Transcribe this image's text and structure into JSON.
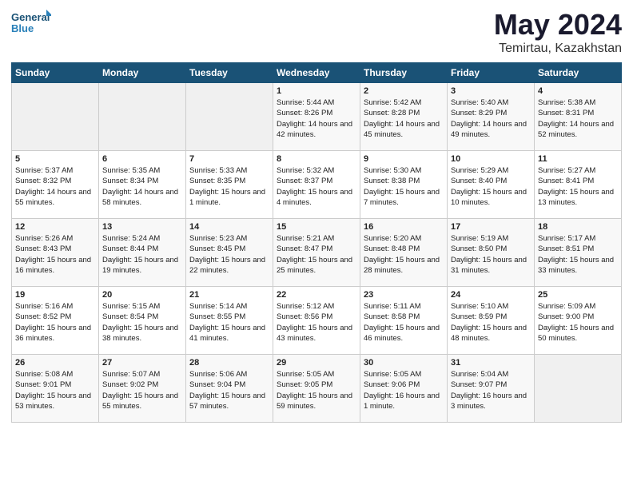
{
  "header": {
    "logo_line1": "General",
    "logo_line2": "Blue",
    "title": "May 2024",
    "location": "Temirtau, Kazakhstan"
  },
  "weekdays": [
    "Sunday",
    "Monday",
    "Tuesday",
    "Wednesday",
    "Thursday",
    "Friday",
    "Saturday"
  ],
  "weeks": [
    [
      {
        "day": "",
        "empty": true
      },
      {
        "day": "",
        "empty": true
      },
      {
        "day": "",
        "empty": true
      },
      {
        "day": "1",
        "sunrise": "5:44 AM",
        "sunset": "8:26 PM",
        "daylight": "14 hours and 42 minutes."
      },
      {
        "day": "2",
        "sunrise": "5:42 AM",
        "sunset": "8:28 PM",
        "daylight": "14 hours and 45 minutes."
      },
      {
        "day": "3",
        "sunrise": "5:40 AM",
        "sunset": "8:29 PM",
        "daylight": "14 hours and 49 minutes."
      },
      {
        "day": "4",
        "sunrise": "5:38 AM",
        "sunset": "8:31 PM",
        "daylight": "14 hours and 52 minutes."
      }
    ],
    [
      {
        "day": "5",
        "sunrise": "5:37 AM",
        "sunset": "8:32 PM",
        "daylight": "14 hours and 55 minutes."
      },
      {
        "day": "6",
        "sunrise": "5:35 AM",
        "sunset": "8:34 PM",
        "daylight": "14 hours and 58 minutes."
      },
      {
        "day": "7",
        "sunrise": "5:33 AM",
        "sunset": "8:35 PM",
        "daylight": "15 hours and 1 minute."
      },
      {
        "day": "8",
        "sunrise": "5:32 AM",
        "sunset": "8:37 PM",
        "daylight": "15 hours and 4 minutes."
      },
      {
        "day": "9",
        "sunrise": "5:30 AM",
        "sunset": "8:38 PM",
        "daylight": "15 hours and 7 minutes."
      },
      {
        "day": "10",
        "sunrise": "5:29 AM",
        "sunset": "8:40 PM",
        "daylight": "15 hours and 10 minutes."
      },
      {
        "day": "11",
        "sunrise": "5:27 AM",
        "sunset": "8:41 PM",
        "daylight": "15 hours and 13 minutes."
      }
    ],
    [
      {
        "day": "12",
        "sunrise": "5:26 AM",
        "sunset": "8:43 PM",
        "daylight": "15 hours and 16 minutes."
      },
      {
        "day": "13",
        "sunrise": "5:24 AM",
        "sunset": "8:44 PM",
        "daylight": "15 hours and 19 minutes."
      },
      {
        "day": "14",
        "sunrise": "5:23 AM",
        "sunset": "8:45 PM",
        "daylight": "15 hours and 22 minutes."
      },
      {
        "day": "15",
        "sunrise": "5:21 AM",
        "sunset": "8:47 PM",
        "daylight": "15 hours and 25 minutes."
      },
      {
        "day": "16",
        "sunrise": "5:20 AM",
        "sunset": "8:48 PM",
        "daylight": "15 hours and 28 minutes."
      },
      {
        "day": "17",
        "sunrise": "5:19 AM",
        "sunset": "8:50 PM",
        "daylight": "15 hours and 31 minutes."
      },
      {
        "day": "18",
        "sunrise": "5:17 AM",
        "sunset": "8:51 PM",
        "daylight": "15 hours and 33 minutes."
      }
    ],
    [
      {
        "day": "19",
        "sunrise": "5:16 AM",
        "sunset": "8:52 PM",
        "daylight": "15 hours and 36 minutes."
      },
      {
        "day": "20",
        "sunrise": "5:15 AM",
        "sunset": "8:54 PM",
        "daylight": "15 hours and 38 minutes."
      },
      {
        "day": "21",
        "sunrise": "5:14 AM",
        "sunset": "8:55 PM",
        "daylight": "15 hours and 41 minutes."
      },
      {
        "day": "22",
        "sunrise": "5:12 AM",
        "sunset": "8:56 PM",
        "daylight": "15 hours and 43 minutes."
      },
      {
        "day": "23",
        "sunrise": "5:11 AM",
        "sunset": "8:58 PM",
        "daylight": "15 hours and 46 minutes."
      },
      {
        "day": "24",
        "sunrise": "5:10 AM",
        "sunset": "8:59 PM",
        "daylight": "15 hours and 48 minutes."
      },
      {
        "day": "25",
        "sunrise": "5:09 AM",
        "sunset": "9:00 PM",
        "daylight": "15 hours and 50 minutes."
      }
    ],
    [
      {
        "day": "26",
        "sunrise": "5:08 AM",
        "sunset": "9:01 PM",
        "daylight": "15 hours and 53 minutes."
      },
      {
        "day": "27",
        "sunrise": "5:07 AM",
        "sunset": "9:02 PM",
        "daylight": "15 hours and 55 minutes."
      },
      {
        "day": "28",
        "sunrise": "5:06 AM",
        "sunset": "9:04 PM",
        "daylight": "15 hours and 57 minutes."
      },
      {
        "day": "29",
        "sunrise": "5:05 AM",
        "sunset": "9:05 PM",
        "daylight": "15 hours and 59 minutes."
      },
      {
        "day": "30",
        "sunrise": "5:05 AM",
        "sunset": "9:06 PM",
        "daylight": "16 hours and 1 minute."
      },
      {
        "day": "31",
        "sunrise": "5:04 AM",
        "sunset": "9:07 PM",
        "daylight": "16 hours and 3 minutes."
      },
      {
        "day": "",
        "empty": true
      }
    ]
  ]
}
